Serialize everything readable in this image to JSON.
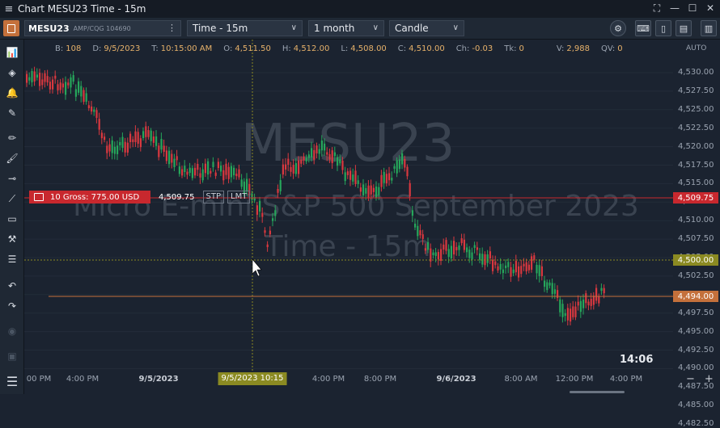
{
  "window": {
    "title": "Chart MESU23 Time - 15m"
  },
  "toolbar": {
    "symbol": "MESU23",
    "account": "AMP/CQG 104690",
    "interval": "Time - 15m",
    "range": "1 month",
    "chart_type": "Candle"
  },
  "ohlc": {
    "bar_label": "B:",
    "bar": "108",
    "date_label": "D:",
    "date": "9/5/2023",
    "time_label": "T:",
    "time": "10:15:00 AM",
    "open_label": "O:",
    "open": "4,511.50",
    "high_label": "H:",
    "high": "4,512.00",
    "low_label": "L:",
    "low": "4,508.00",
    "close_label": "C:",
    "close": "4,510.00",
    "change_label": "Ch:",
    "change": "-0.03",
    "ticks_label": "Tk:",
    "ticks": "0",
    "volume_label": "V:",
    "volume": "2,988",
    "qv_label": "QV:",
    "qv": "0"
  },
  "watermark": {
    "symbol": "MESU23",
    "description": "Micro E-mini S&P 500 September 2023",
    "interval": "Time - 15m"
  },
  "position": {
    "label": "10 Gross: 775.00 USD",
    "price": "4,509.75",
    "stp": "STP",
    "lmt": "LMT"
  },
  "yaxis": {
    "auto": "AUTO",
    "labels": [
      "4,530.00",
      "4,527.50",
      "4,525.00",
      "4,522.50",
      "4,520.00",
      "4,517.50",
      "4,515.00",
      "4,512.50",
      "4,510.00",
      "4,507.50",
      "4,505.00",
      "4,502.50",
      "4,500.00",
      "4,497.50",
      "4,495.00",
      "4,492.50",
      "4,490.00",
      "4,487.50",
      "4,485.00",
      "4,482.50"
    ],
    "position_badge": "4,509.75",
    "crosshair_badge": "4,500.00",
    "last_badge": "4,494.00",
    "position_color": "#c8282e",
    "crosshair_color": "#8b8a22",
    "last_color": "#c4703b"
  },
  "xaxis": {
    "labels": [
      "00 PM",
      "4:00 PM",
      "9/5/2023",
      "4:00 PM",
      "8:00 PM",
      "9/6/2023",
      "8:00 AM",
      "12:00 PM",
      "4:00 PM"
    ],
    "crosshair_badge": "9/5/2023 10:15"
  },
  "clock": "14:06",
  "colors": {
    "up": "#26a65b",
    "down": "#d9383f",
    "background": "#1b2330"
  }
}
